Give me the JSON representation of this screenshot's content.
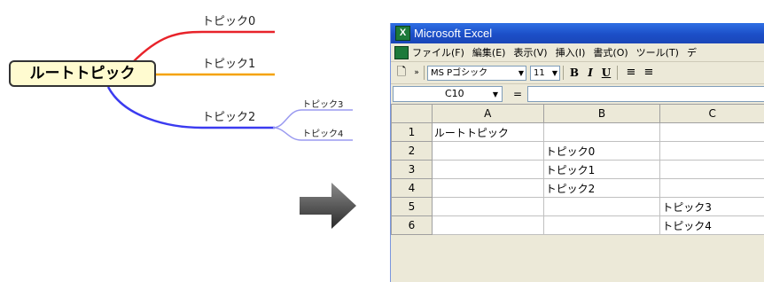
{
  "mindmap": {
    "root": "ルートトピック",
    "topics": [
      "トピック0",
      "トピック1",
      "トピック2"
    ],
    "subtopics": [
      "トピック3",
      "トピック4"
    ],
    "colors": {
      "topic0": "#e8232a",
      "topic1": "#f5a200",
      "topic2": "#3b3bf0",
      "sub": "#9a9af0"
    }
  },
  "excel": {
    "title": "Microsoft Excel",
    "menu": [
      "ファイル(F)",
      "編集(E)",
      "表示(V)",
      "挿入(I)",
      "書式(O)",
      "ツール(T)",
      "デ"
    ],
    "toolbar": {
      "font_name": "MS Pゴシック",
      "font_size": "11",
      "bold": "B",
      "italic": "I",
      "underline": "U"
    },
    "name_box": "C10",
    "formula_symbol": "=",
    "columns": [
      "A",
      "B",
      "C"
    ],
    "rows": [
      {
        "num": "1",
        "A": "ルートトピック",
        "B": "",
        "C": ""
      },
      {
        "num": "2",
        "A": "",
        "B": "トピック0",
        "C": ""
      },
      {
        "num": "3",
        "A": "",
        "B": "トピック1",
        "C": ""
      },
      {
        "num": "4",
        "A": "",
        "B": "トピック2",
        "C": ""
      },
      {
        "num": "5",
        "A": "",
        "B": "",
        "C": "トピック3"
      },
      {
        "num": "6",
        "A": "",
        "B": "",
        "C": "トピック4"
      }
    ]
  }
}
